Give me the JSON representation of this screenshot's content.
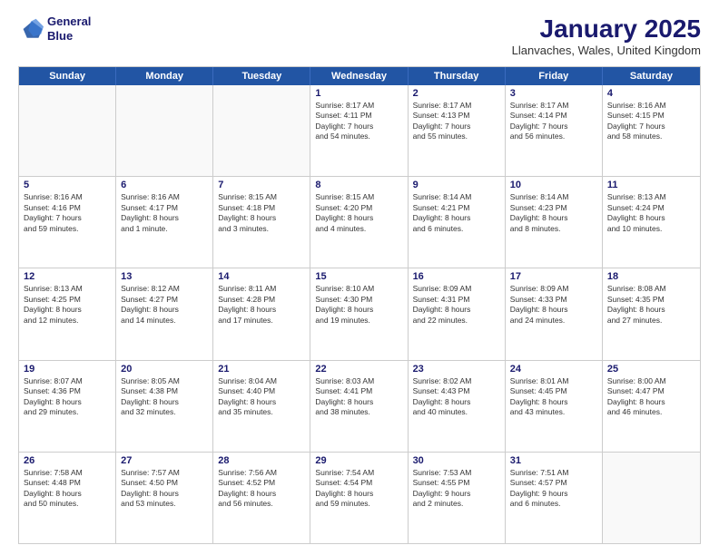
{
  "logo": {
    "line1": "General",
    "line2": "Blue"
  },
  "header": {
    "title": "January 2025",
    "subtitle": "Llanvaches, Wales, United Kingdom"
  },
  "day_headers": [
    "Sunday",
    "Monday",
    "Tuesday",
    "Wednesday",
    "Thursday",
    "Friday",
    "Saturday"
  ],
  "weeks": [
    [
      {
        "day": "",
        "info": "",
        "empty": true
      },
      {
        "day": "",
        "info": "",
        "empty": true
      },
      {
        "day": "",
        "info": "",
        "empty": true
      },
      {
        "day": "1",
        "info": "Sunrise: 8:17 AM\nSunset: 4:11 PM\nDaylight: 7 hours\nand 54 minutes.",
        "empty": false
      },
      {
        "day": "2",
        "info": "Sunrise: 8:17 AM\nSunset: 4:13 PM\nDaylight: 7 hours\nand 55 minutes.",
        "empty": false
      },
      {
        "day": "3",
        "info": "Sunrise: 8:17 AM\nSunset: 4:14 PM\nDaylight: 7 hours\nand 56 minutes.",
        "empty": false
      },
      {
        "day": "4",
        "info": "Sunrise: 8:16 AM\nSunset: 4:15 PM\nDaylight: 7 hours\nand 58 minutes.",
        "empty": false
      }
    ],
    [
      {
        "day": "5",
        "info": "Sunrise: 8:16 AM\nSunset: 4:16 PM\nDaylight: 7 hours\nand 59 minutes.",
        "empty": false
      },
      {
        "day": "6",
        "info": "Sunrise: 8:16 AM\nSunset: 4:17 PM\nDaylight: 8 hours\nand 1 minute.",
        "empty": false
      },
      {
        "day": "7",
        "info": "Sunrise: 8:15 AM\nSunset: 4:18 PM\nDaylight: 8 hours\nand 3 minutes.",
        "empty": false
      },
      {
        "day": "8",
        "info": "Sunrise: 8:15 AM\nSunset: 4:20 PM\nDaylight: 8 hours\nand 4 minutes.",
        "empty": false
      },
      {
        "day": "9",
        "info": "Sunrise: 8:14 AM\nSunset: 4:21 PM\nDaylight: 8 hours\nand 6 minutes.",
        "empty": false
      },
      {
        "day": "10",
        "info": "Sunrise: 8:14 AM\nSunset: 4:23 PM\nDaylight: 8 hours\nand 8 minutes.",
        "empty": false
      },
      {
        "day": "11",
        "info": "Sunrise: 8:13 AM\nSunset: 4:24 PM\nDaylight: 8 hours\nand 10 minutes.",
        "empty": false
      }
    ],
    [
      {
        "day": "12",
        "info": "Sunrise: 8:13 AM\nSunset: 4:25 PM\nDaylight: 8 hours\nand 12 minutes.",
        "empty": false
      },
      {
        "day": "13",
        "info": "Sunrise: 8:12 AM\nSunset: 4:27 PM\nDaylight: 8 hours\nand 14 minutes.",
        "empty": false
      },
      {
        "day": "14",
        "info": "Sunrise: 8:11 AM\nSunset: 4:28 PM\nDaylight: 8 hours\nand 17 minutes.",
        "empty": false
      },
      {
        "day": "15",
        "info": "Sunrise: 8:10 AM\nSunset: 4:30 PM\nDaylight: 8 hours\nand 19 minutes.",
        "empty": false
      },
      {
        "day": "16",
        "info": "Sunrise: 8:09 AM\nSunset: 4:31 PM\nDaylight: 8 hours\nand 22 minutes.",
        "empty": false
      },
      {
        "day": "17",
        "info": "Sunrise: 8:09 AM\nSunset: 4:33 PM\nDaylight: 8 hours\nand 24 minutes.",
        "empty": false
      },
      {
        "day": "18",
        "info": "Sunrise: 8:08 AM\nSunset: 4:35 PM\nDaylight: 8 hours\nand 27 minutes.",
        "empty": false
      }
    ],
    [
      {
        "day": "19",
        "info": "Sunrise: 8:07 AM\nSunset: 4:36 PM\nDaylight: 8 hours\nand 29 minutes.",
        "empty": false
      },
      {
        "day": "20",
        "info": "Sunrise: 8:05 AM\nSunset: 4:38 PM\nDaylight: 8 hours\nand 32 minutes.",
        "empty": false
      },
      {
        "day": "21",
        "info": "Sunrise: 8:04 AM\nSunset: 4:40 PM\nDaylight: 8 hours\nand 35 minutes.",
        "empty": false
      },
      {
        "day": "22",
        "info": "Sunrise: 8:03 AM\nSunset: 4:41 PM\nDaylight: 8 hours\nand 38 minutes.",
        "empty": false
      },
      {
        "day": "23",
        "info": "Sunrise: 8:02 AM\nSunset: 4:43 PM\nDaylight: 8 hours\nand 40 minutes.",
        "empty": false
      },
      {
        "day": "24",
        "info": "Sunrise: 8:01 AM\nSunset: 4:45 PM\nDaylight: 8 hours\nand 43 minutes.",
        "empty": false
      },
      {
        "day": "25",
        "info": "Sunrise: 8:00 AM\nSunset: 4:47 PM\nDaylight: 8 hours\nand 46 minutes.",
        "empty": false
      }
    ],
    [
      {
        "day": "26",
        "info": "Sunrise: 7:58 AM\nSunset: 4:48 PM\nDaylight: 8 hours\nand 50 minutes.",
        "empty": false
      },
      {
        "day": "27",
        "info": "Sunrise: 7:57 AM\nSunset: 4:50 PM\nDaylight: 8 hours\nand 53 minutes.",
        "empty": false
      },
      {
        "day": "28",
        "info": "Sunrise: 7:56 AM\nSunset: 4:52 PM\nDaylight: 8 hours\nand 56 minutes.",
        "empty": false
      },
      {
        "day": "29",
        "info": "Sunrise: 7:54 AM\nSunset: 4:54 PM\nDaylight: 8 hours\nand 59 minutes.",
        "empty": false
      },
      {
        "day": "30",
        "info": "Sunrise: 7:53 AM\nSunset: 4:55 PM\nDaylight: 9 hours\nand 2 minutes.",
        "empty": false
      },
      {
        "day": "31",
        "info": "Sunrise: 7:51 AM\nSunset: 4:57 PM\nDaylight: 9 hours\nand 6 minutes.",
        "empty": false
      },
      {
        "day": "",
        "info": "",
        "empty": true
      }
    ]
  ]
}
